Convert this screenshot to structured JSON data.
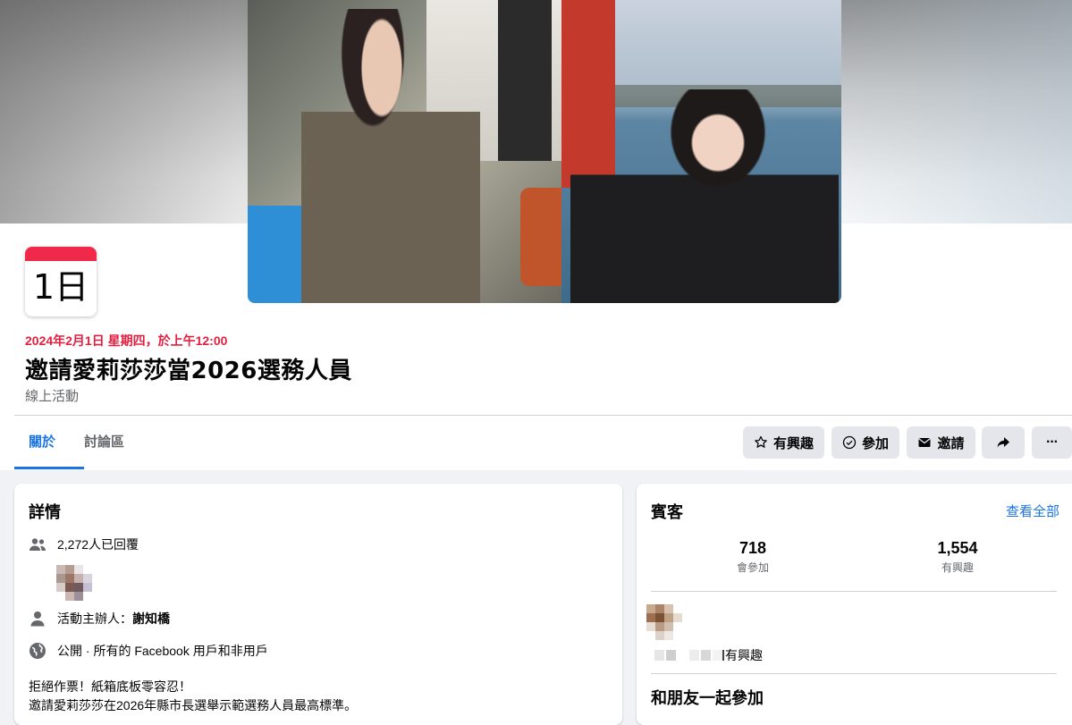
{
  "event": {
    "calendar_day": "1日",
    "date_line": "2024年2月1日 星期四，於上午12:00",
    "title": "邀請愛莉莎莎當2026選務人員",
    "type": "線上活動"
  },
  "tabs": [
    {
      "label": "關於",
      "active": true
    },
    {
      "label": "討論區",
      "active": false
    }
  ],
  "actions": {
    "interested": "有興趣",
    "going": "參加",
    "invite": "邀請",
    "share_icon": "share-icon",
    "more": "···"
  },
  "details": {
    "title": "詳情",
    "responded": "2,272人已回覆",
    "host_prefix": "活動主辦人：",
    "host_name": "謝知橋",
    "privacy": "公開 · 所有的 Facebook 用戶和非用戶",
    "desc_line1": "拒絕作票！紙箱底板零容忍！",
    "desc_line2": "邀請愛莉莎莎在2026年縣市長選舉示範選務人員最高標準。"
  },
  "guests": {
    "title": "賓客",
    "see_all": "查看全部",
    "going_count": "718",
    "going_label": "會參加",
    "interested_count": "1,554",
    "interested_label": "有興趣",
    "friend_interest": "有興趣",
    "join_with_friends": "和朋友一起參加"
  },
  "colors": {
    "accent": "#1b74e4",
    "date_red": "#e41e3f",
    "calendar_red": "#f02849",
    "button_bg": "#e4e6eb"
  }
}
